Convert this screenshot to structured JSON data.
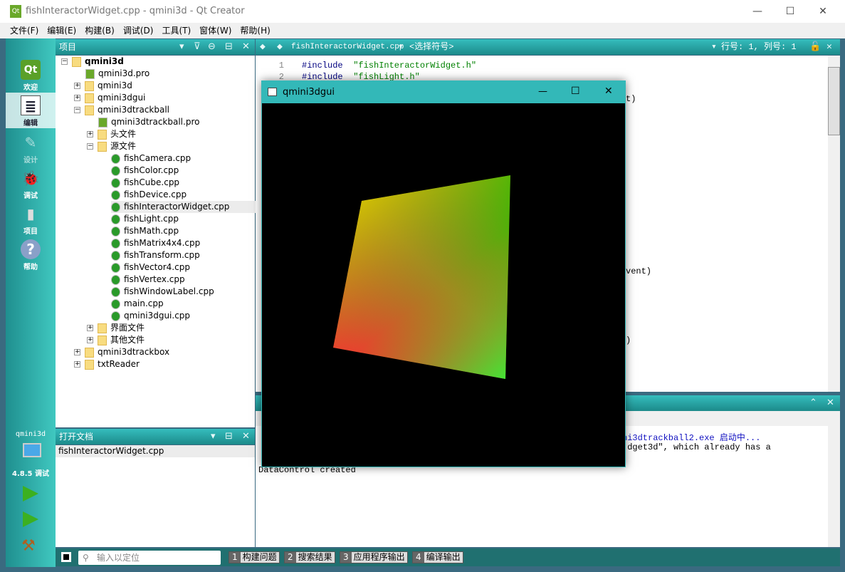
{
  "window": {
    "title": "fishInteractorWidget.cpp - qmini3d - Qt Creator",
    "min": "—",
    "max": "☐",
    "close": "✕"
  },
  "menu": [
    "文件(F)",
    "编辑(E)",
    "构建(B)",
    "调试(D)",
    "工具(T)",
    "窗体(W)",
    "帮助(H)"
  ],
  "modes": [
    {
      "label": "欢迎",
      "icon": "Qt"
    },
    {
      "label": "编辑",
      "icon": "≣"
    },
    {
      "label": "设计",
      "icon": "✎"
    },
    {
      "label": "调试",
      "icon": "🐞"
    },
    {
      "label": "项目",
      "icon": "▮"
    },
    {
      "label": "帮助",
      "icon": "?"
    }
  ],
  "kit": {
    "project": "qmini3d",
    "config": "4.8.5 调试"
  },
  "projects": {
    "title": "项目",
    "tree": [
      {
        "label": "qmini3d",
        "type": "qt-folder",
        "ex": "−",
        "lvl": 0,
        "bold": true
      },
      {
        "label": "qmini3d.pro",
        "type": "pro",
        "lvl": 1
      },
      {
        "label": "qmini3d",
        "type": "qt-folder",
        "ex": "+",
        "lvl": 1
      },
      {
        "label": "qmini3dgui",
        "type": "qt-folder",
        "ex": "+",
        "lvl": 1
      },
      {
        "label": "qmini3dtrackball",
        "type": "qt-folder",
        "ex": "−",
        "lvl": 1
      },
      {
        "label": "qmini3dtrackball.pro",
        "type": "pro",
        "lvl": 2
      },
      {
        "label": "头文件",
        "type": "h-folder",
        "ex": "+",
        "lvl": 2
      },
      {
        "label": "源文件",
        "type": "cpp-folder",
        "ex": "−",
        "lvl": 2
      },
      {
        "label": "fishCamera.cpp",
        "type": "cpp",
        "lvl": 3
      },
      {
        "label": "fishColor.cpp",
        "type": "cpp",
        "lvl": 3
      },
      {
        "label": "fishCube.cpp",
        "type": "cpp",
        "lvl": 3
      },
      {
        "label": "fishDevice.cpp",
        "type": "cpp",
        "lvl": 3
      },
      {
        "label": "fishInteractorWidget.cpp",
        "type": "cpp",
        "lvl": 3,
        "selected": true
      },
      {
        "label": "fishLight.cpp",
        "type": "cpp",
        "lvl": 3
      },
      {
        "label": "fishMath.cpp",
        "type": "cpp",
        "lvl": 3
      },
      {
        "label": "fishMatrix4x4.cpp",
        "type": "cpp",
        "lvl": 3
      },
      {
        "label": "fishTransform.cpp",
        "type": "cpp",
        "lvl": 3
      },
      {
        "label": "fishVector4.cpp",
        "type": "cpp",
        "lvl": 3
      },
      {
        "label": "fishVertex.cpp",
        "type": "cpp",
        "lvl": 3
      },
      {
        "label": "fishWindowLabel.cpp",
        "type": "cpp",
        "lvl": 3
      },
      {
        "label": "main.cpp",
        "type": "cpp",
        "lvl": 3
      },
      {
        "label": "qmini3dgui.cpp",
        "type": "cpp",
        "lvl": 3
      },
      {
        "label": "界面文件",
        "type": "ui-folder",
        "ex": "+",
        "lvl": 2
      },
      {
        "label": "其他文件",
        "type": "other-folder",
        "ex": "+",
        "lvl": 2
      },
      {
        "label": "qmini3dtrackbox",
        "type": "qt-folder",
        "ex": "+",
        "lvl": 1
      },
      {
        "label": "txtReader",
        "type": "qt-folder",
        "ex": "+",
        "lvl": 1
      }
    ]
  },
  "open_docs": {
    "title": "打开文档",
    "items": [
      "fishInteractorWidget.cpp"
    ]
  },
  "editor": {
    "file": "fishInteractorWidget.cpp",
    "symbol": "<选择符号>",
    "position": "行号: 1, 列号: 1",
    "lines": [
      {
        "n": "1",
        "kw": "#include",
        "str": " \"fishInteractorWidget.h\""
      },
      {
        "n": "2",
        "kw": "#include",
        "str": " \"fishLight.h\""
      }
    ],
    "fragments": [
      "t)",
      "vent)",
      ")"
    ]
  },
  "output": {
    "lines": [
      "ni3dtrackball2.exe 启动中...",
      ".dget3d\", which already has a",
      "DataControl created"
    ]
  },
  "locator": {
    "placeholder": "输入以定位"
  },
  "output_tabs": [
    {
      "n": "1",
      "label": "构建问题"
    },
    {
      "n": "2",
      "label": "搜索结果"
    },
    {
      "n": "3",
      "label": "应用程序输出"
    },
    {
      "n": "4",
      "label": "编译输出"
    }
  ],
  "app_window": {
    "title": "qmini3dgui",
    "min": "—",
    "max": "☐",
    "close": "✕"
  },
  "colors": {
    "teal": "#33b8b8",
    "quad_red": "#f03a30",
    "quad_yellow": "#c8c000",
    "quad_green": "#30f030"
  }
}
